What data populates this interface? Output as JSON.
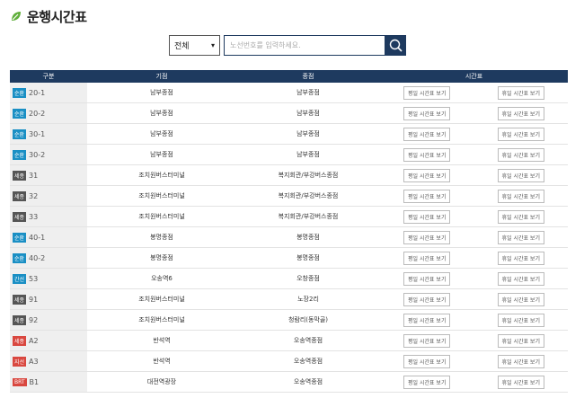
{
  "page": {
    "title": "운행시간표"
  },
  "search": {
    "selected": "전체",
    "placeholder": "노선번호를 입력하세요."
  },
  "table": {
    "headers": [
      "구분",
      "기점",
      "종점",
      "시간표"
    ],
    "weekday_label": "평일 시간표 보기",
    "holiday_label": "휴일 시간표 보기",
    "rows": [
      {
        "badge": "순환",
        "color": "#1a8fc4",
        "num": "20-1",
        "start": "남부종점",
        "end": "남부종점"
      },
      {
        "badge": "순환",
        "color": "#1a8fc4",
        "num": "20-2",
        "start": "남부종점",
        "end": "남부종점"
      },
      {
        "badge": "순환",
        "color": "#1a8fc4",
        "num": "30-1",
        "start": "남부종점",
        "end": "남부종점"
      },
      {
        "badge": "순환",
        "color": "#1a8fc4",
        "num": "30-2",
        "start": "남부종점",
        "end": "남부종점"
      },
      {
        "badge": "세종",
        "color": "#555555",
        "num": "31",
        "start": "조치원버스터미널",
        "end": "복지회관/부강버스종점"
      },
      {
        "badge": "세종",
        "color": "#555555",
        "num": "32",
        "start": "조치원버스터미널",
        "end": "복지회관/부강버스종점"
      },
      {
        "badge": "세종",
        "color": "#555555",
        "num": "33",
        "start": "조치원버스터미널",
        "end": "복지회관/부강버스종점"
      },
      {
        "badge": "순환",
        "color": "#1a8fc4",
        "num": "40-1",
        "start": "봉명종점",
        "end": "봉명종점"
      },
      {
        "badge": "순환",
        "color": "#1a8fc4",
        "num": "40-2",
        "start": "봉명종점",
        "end": "봉명종점"
      },
      {
        "badge": "간선",
        "color": "#1a8fc4",
        "num": "53",
        "start": "오송역6",
        "end": "오창종점"
      },
      {
        "badge": "세종",
        "color": "#555555",
        "num": "91",
        "start": "조치원버스터미널",
        "end": "노장2리"
      },
      {
        "badge": "세종",
        "color": "#555555",
        "num": "92",
        "start": "조치원버스터미널",
        "end": "청람리(동막골)"
      },
      {
        "badge": "세종",
        "color": "#d9473f",
        "num": "A2",
        "start": "반석역",
        "end": "오송역종점"
      },
      {
        "badge": "지선",
        "color": "#d9473f",
        "num": "A3",
        "start": "반석역",
        "end": "오송역종점"
      },
      {
        "badge": "BRT",
        "color": "#d9473f",
        "num": "B1",
        "start": "대전역광장",
        "end": "오송역종점"
      }
    ]
  }
}
